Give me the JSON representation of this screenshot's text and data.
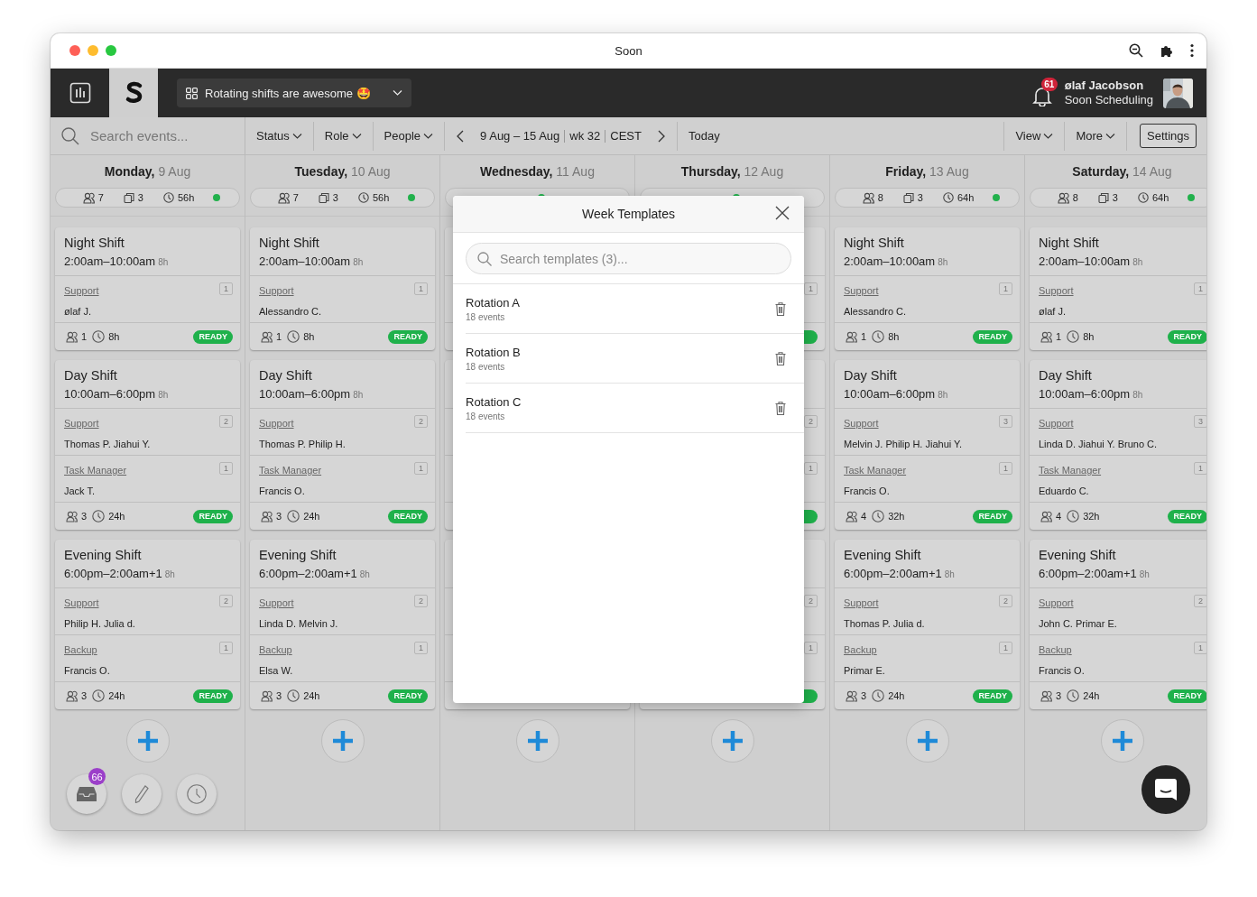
{
  "browser": {
    "title": "Soon"
  },
  "app_bar": {
    "project": "Rotating shifts are awesome 🤩",
    "notifications": "61",
    "user_name": "ølaf Jacobson",
    "organization": "Soon Scheduling"
  },
  "toolbar": {
    "search_placeholder": "Search events...",
    "filters": [
      "Status",
      "Role",
      "People"
    ],
    "range": "9 Aug – 15 Aug",
    "week": "wk 32",
    "timezone": "CEST",
    "today": "Today",
    "menus": [
      "View",
      "More"
    ],
    "settings": "Settings"
  },
  "days": [
    {
      "title": "**Monday,** 9 Aug",
      "people": "7",
      "events": "3",
      "hours": "56h",
      "online": true,
      "cards": [
        {
          "title": "Night Shift",
          "time": "2:00am–10:00am",
          "duration": "8h",
          "sections": [
            {
              "kind": "role",
              "role": "Support",
              "count": "1",
              "people": "ølaf J."
            }
          ],
          "people": "1",
          "hours": "8h",
          "ready": true,
          "badge": "READY"
        },
        {
          "title": "Day Shift",
          "time": "10:00am–6:00pm",
          "duration": "8h",
          "sections": [
            {
              "kind": "role",
              "role": "Support",
              "count": "2",
              "people": "Thomas P. Jiahui Y."
            },
            {
              "kind": "role",
              "role": "Task Manager",
              "count": "1",
              "people": "Jack T."
            }
          ],
          "people": "3",
          "hours": "24h",
          "ready": true,
          "badge": "READY"
        },
        {
          "title": "Evening Shift",
          "time": "6:00pm–2:00am+1",
          "duration": "8h",
          "sections": [
            {
              "kind": "role",
              "role": "Support",
              "count": "2",
              "people": "Philip H. Julia d."
            },
            {
              "kind": "role",
              "role": "Backup",
              "count": "1",
              "people": "Francis O."
            }
          ],
          "people": "3",
          "hours": "24h",
          "ready": true,
          "badge": "READY"
        }
      ]
    },
    {
      "title": "**Tuesday,** 10 Aug",
      "people": "7",
      "events": "3",
      "hours": "56h",
      "online": true,
      "cards": [
        {
          "title": "Night Shift",
          "time": "2:00am–10:00am",
          "duration": "8h",
          "sections": [
            {
              "kind": "role",
              "role": "Support",
              "count": "1",
              "people": "Alessandro C."
            }
          ],
          "people": "1",
          "hours": "8h",
          "ready": true,
          "badge": "READY"
        },
        {
          "title": "Day Shift",
          "time": "10:00am–6:00pm",
          "duration": "8h",
          "sections": [
            {
              "kind": "role",
              "role": "Support",
              "count": "2",
              "people": "Thomas P. Philip H."
            },
            {
              "kind": "role",
              "role": "Task Manager",
              "count": "1",
              "people": "Francis O."
            }
          ],
          "people": "3",
          "hours": "24h",
          "ready": true,
          "badge": "READY"
        },
        {
          "title": "Evening Shift",
          "time": "6:00pm–2:00am+1",
          "duration": "8h",
          "sections": [
            {
              "kind": "role",
              "role": "Support",
              "count": "2",
              "people": "Linda D. Melvin J."
            },
            {
              "kind": "role",
              "role": "Backup",
              "count": "1",
              "people": "Elsa W."
            }
          ],
          "people": "3",
          "hours": "24h",
          "ready": true,
          "badge": "READY"
        }
      ]
    },
    {
      "title": "**Wednesday,** 11 Aug",
      "online": true,
      "cards": [
        {
          "sections": [
            {
              "kind": "role"
            }
          ]
        },
        {
          "sections": [
            {
              "kind": "role"
            },
            {
              "kind": "role"
            }
          ]
        },
        {
          "sections": [
            {
              "kind": "role"
            },
            {
              "kind": "role"
            }
          ]
        }
      ]
    },
    {
      "title": "**Thursday,** 12 Aug",
      "online": true,
      "cards": [
        {
          "sections": [
            {
              "kind": "role",
              "count": "1"
            }
          ],
          "ready": true
        },
        {
          "sections": [
            {
              "kind": "role",
              "count": "2"
            },
            {
              "kind": "role",
              "count": "1"
            }
          ],
          "ready": true
        },
        {
          "sections": [
            {
              "kind": "role",
              "count": "2"
            },
            {
              "kind": "role",
              "count": "1"
            }
          ],
          "ready": true
        }
      ]
    },
    {
      "title": "**Friday,** 13 Aug",
      "people": "8",
      "events": "3",
      "hours": "64h",
      "online": true,
      "cards": [
        {
          "title": "Night Shift",
          "time": "2:00am–10:00am",
          "duration": "8h",
          "sections": [
            {
              "kind": "role",
              "role": "Support",
              "count": "1",
              "people": "Alessandro C."
            }
          ],
          "people": "1",
          "hours": "8h",
          "ready": true,
          "badge": "READY"
        },
        {
          "title": "Day Shift",
          "time": "10:00am–6:00pm",
          "duration": "8h",
          "sections": [
            {
              "kind": "role",
              "role": "Support",
              "count": "3",
              "people": "Melvin J. Philip H. Jiahui Y."
            },
            {
              "kind": "role",
              "role": "Task Manager",
              "count": "1",
              "people": "Francis O."
            }
          ],
          "people": "4",
          "hours": "32h",
          "ready": true,
          "badge": "READY"
        },
        {
          "title": "Evening Shift",
          "time": "6:00pm–2:00am+1",
          "duration": "8h",
          "sections": [
            {
              "kind": "role",
              "role": "Support",
              "count": "2",
              "people": "Thomas P. Julia d."
            },
            {
              "kind": "role",
              "role": "Backup",
              "count": "1",
              "people": "Primar E."
            }
          ],
          "people": "3",
          "hours": "24h",
          "ready": true,
          "badge": "READY"
        }
      ]
    },
    {
      "title": "**Saturday,** 14 Aug",
      "people": "8",
      "events": "3",
      "hours": "64h",
      "online": true,
      "cards": [
        {
          "title": "Night Shift",
          "time": "2:00am–10:00am",
          "duration": "8h",
          "sections": [
            {
              "kind": "role",
              "role": "Support",
              "count": "1",
              "people": "ølaf J."
            }
          ],
          "people": "1",
          "hours": "8h",
          "ready": true,
          "badge": "READY"
        },
        {
          "title": "Day Shift",
          "time": "10:00am–6:00pm",
          "duration": "8h",
          "sections": [
            {
              "kind": "role",
              "role": "Support",
              "count": "3",
              "people": "Linda D. Jiahui Y. Bruno C."
            },
            {
              "kind": "role",
              "role": "Task Manager",
              "count": "1",
              "people": "Eduardo C."
            }
          ],
          "people": "4",
          "hours": "32h",
          "ready": true,
          "badge": "READY"
        },
        {
          "title": "Evening Shift",
          "time": "6:00pm–2:00am+1",
          "duration": "8h",
          "sections": [
            {
              "kind": "role",
              "role": "Support",
              "count": "2",
              "people": "John C. Primar E."
            },
            {
              "kind": "role",
              "role": "Backup",
              "count": "1",
              "people": "Francis O."
            }
          ],
          "people": "3",
          "hours": "24h",
          "ready": true,
          "badge": "READY"
        }
      ]
    }
  ],
  "modal": {
    "title": "Week Templates",
    "search_placeholder": "Search templates (3)...",
    "templates": [
      {
        "name": "Rotation A",
        "events": "18 events"
      },
      {
        "name": "Rotation B",
        "events": "18 events"
      },
      {
        "name": "Rotation C",
        "events": "18 events"
      }
    ]
  },
  "inbox": {
    "count": "66"
  }
}
